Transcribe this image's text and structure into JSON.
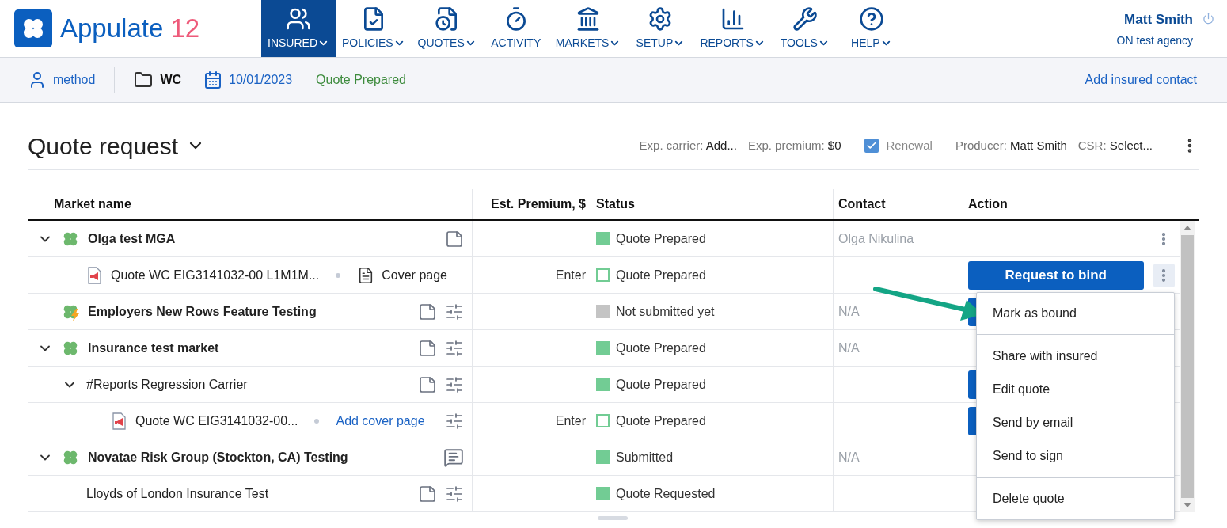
{
  "logo": {
    "name": "Appulate",
    "version": "12"
  },
  "nav": [
    {
      "label": "INSURED",
      "selected": true,
      "caret": true
    },
    {
      "label": "POLICIES",
      "selected": false,
      "caret": true
    },
    {
      "label": "QUOTES",
      "selected": false,
      "caret": true
    },
    {
      "label": "ACTIVITY",
      "selected": false,
      "caret": false
    },
    {
      "label": "MARKETS",
      "selected": false,
      "caret": true
    },
    {
      "label": "SETUP",
      "selected": false,
      "caret": true
    },
    {
      "label": "REPORTS",
      "selected": false,
      "caret": true
    },
    {
      "label": "TOOLS",
      "selected": false,
      "caret": true
    },
    {
      "label": "HELP",
      "selected": false,
      "caret": true
    }
  ],
  "user": {
    "name": "Matt Smith",
    "agency": "ON test agency"
  },
  "context_bar": {
    "insured": "method",
    "line": "WC",
    "date": "10/01/2023",
    "status": "Quote Prepared",
    "link": "Add insured contact"
  },
  "title": "Quote request",
  "meta": [
    {
      "label": "Exp. carrier:",
      "value": "Add..."
    },
    {
      "label": "Exp. premium:",
      "value": "$0"
    }
  ],
  "renewal": {
    "label": "Renewal",
    "checked": true
  },
  "meta2": [
    {
      "label": "Producer:",
      "value": "Matt Smith"
    },
    {
      "label": "CSR:",
      "value": "Select..."
    }
  ],
  "table": {
    "columns": [
      "Market name",
      "Est. Premium, $",
      "Status",
      "Contact",
      "Action"
    ],
    "rows": [
      {
        "kind": "market",
        "name": "Olga test MGA",
        "expanded": true,
        "tools": [
          {
            "kind": "note"
          }
        ],
        "status": {
          "label": "Quote Prepared",
          "kind": "filled",
          "color": "#72cc94"
        },
        "contact": "Olga Nikulina",
        "action": {
          "kind": "menu"
        },
        "children": [
          {
            "kind": "quote",
            "name": "Quote WC EIG3141032-00 L1M1M...",
            "cover": {
              "kind": "doc",
              "label": "Cover page"
            },
            "premium": "Enter",
            "status": {
              "label": "Quote Prepared",
              "kind": "outline",
              "color": "#72cc94"
            },
            "action": {
              "kind": "bind",
              "label": "Request to bind",
              "menu_open": true
            }
          }
        ]
      },
      {
        "kind": "market",
        "name": "Employers New Rows Feature Testing",
        "flash": true,
        "tools": [
          {
            "kind": "note"
          },
          {
            "kind": "sliders"
          }
        ],
        "status": {
          "label": "Not submitted yet",
          "kind": "filled",
          "color": "#c4c4c4"
        },
        "contact": "N/A",
        "action": {
          "kind": "covered"
        }
      },
      {
        "kind": "market",
        "name": "Insurance test market",
        "expanded": true,
        "tools": [
          {
            "kind": "note"
          },
          {
            "kind": "sliders"
          }
        ],
        "status": {
          "label": "Quote Prepared",
          "kind": "filled",
          "color": "#72cc94"
        },
        "contact": "N/A",
        "action": {
          "kind": "none"
        },
        "children": [
          {
            "kind": "carrier",
            "name": "#Reports Regression Carrier",
            "expanded": true,
            "tools": [
              {
                "kind": "note"
              },
              {
                "kind": "sliders"
              }
            ],
            "status": {
              "label": "Quote Prepared",
              "kind": "filled",
              "color": "#72cc94"
            },
            "action": {
              "kind": "covered"
            },
            "children": [
              {
                "kind": "quote",
                "name": "Quote WC EIG3141032-00...",
                "cover": {
                  "kind": "link",
                  "label": "Add cover page"
                },
                "tools": [
                  {
                    "kind": "sliders"
                  }
                ],
                "premium": "Enter",
                "status": {
                  "label": "Quote Prepared",
                  "kind": "outline",
                  "color": "#72cc94"
                },
                "action": {
                  "kind": "covered"
                }
              }
            ]
          }
        ]
      },
      {
        "kind": "market",
        "name": "Novatae Risk Group (Stockton, CA) Testing",
        "expanded": true,
        "tools": [
          {
            "kind": "chat"
          }
        ],
        "status": {
          "label": "Submitted",
          "kind": "filled",
          "color": "#72cc94"
        },
        "contact": "N/A",
        "action": {
          "kind": "none"
        },
        "children": [
          {
            "kind": "carrier",
            "name": "Lloyds of London Insurance Test",
            "tools": [
              {
                "kind": "note"
              },
              {
                "kind": "sliders"
              }
            ],
            "status": {
              "label": "Quote Requested",
              "kind": "filled",
              "color": "#72cc94"
            },
            "action": {
              "kind": "none"
            }
          }
        ]
      }
    ]
  },
  "action_menu": [
    [
      "Mark as bound"
    ],
    [
      "Share with insured",
      "Edit quote",
      "Send by email",
      "Send to sign"
    ],
    [
      "Delete quote"
    ]
  ]
}
